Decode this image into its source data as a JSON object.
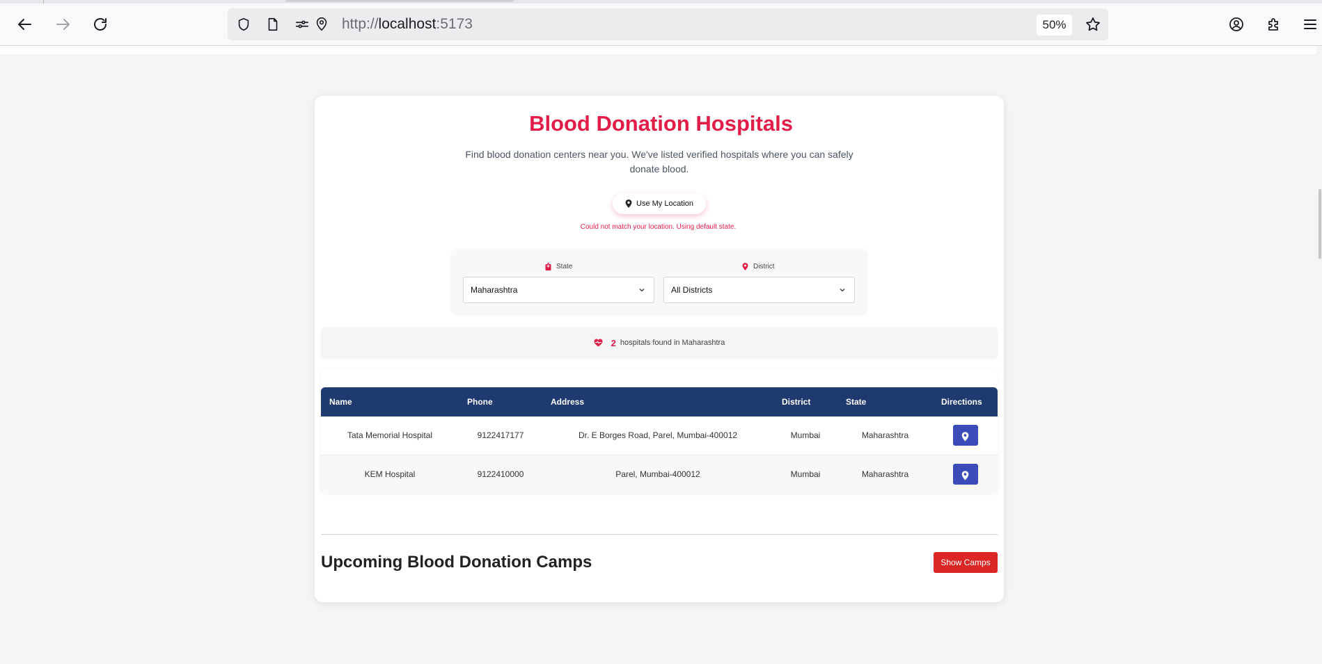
{
  "browser": {
    "url_scheme": "http://",
    "url_host": "localhost",
    "url_port": ":5173",
    "zoom": "50%",
    "icons": [
      "back-arrow-icon",
      "forward-arrow-icon",
      "reload-icon",
      "shield-icon",
      "page-icon",
      "permissions-icon",
      "location-icon",
      "star-icon",
      "account-icon",
      "extensions-icon",
      "menu-icon"
    ]
  },
  "header": {
    "title": "Blood Donation Hospitals",
    "subtitle": "Find blood donation centers near you. We've listed verified hospitals where you can safely donate blood."
  },
  "location": {
    "button_label": "Use My Location",
    "message": "Could not match your location. Using default state."
  },
  "filters": {
    "state_label": "State",
    "state_value": "Maharashtra",
    "district_label": "District",
    "district_value": "All Districts"
  },
  "results": {
    "count": "2",
    "text": "hospitals found in Maharashtra"
  },
  "table": {
    "headers": [
      "Name",
      "Phone",
      "Address",
      "District",
      "State",
      "Directions"
    ],
    "rows": [
      {
        "name": "Tata Memorial Hospital",
        "phone": "9122417177",
        "address": "Dr. E Borges Road, Parel, Mumbai-400012",
        "district": "Mumbai",
        "state": "Maharashtra"
      },
      {
        "name": "KEM Hospital",
        "phone": "9122410000",
        "address": "Parel, Mumbai-400012",
        "district": "Mumbai",
        "state": "Maharashtra"
      }
    ]
  },
  "camps": {
    "title": "Upcoming Blood Donation Camps",
    "button_label": "Show Camps"
  },
  "colors": {
    "accent": "#e11d48",
    "table_header": "#1e3a6e",
    "directions_button": "#3b4bb8",
    "camps_button": "#dc2626"
  }
}
